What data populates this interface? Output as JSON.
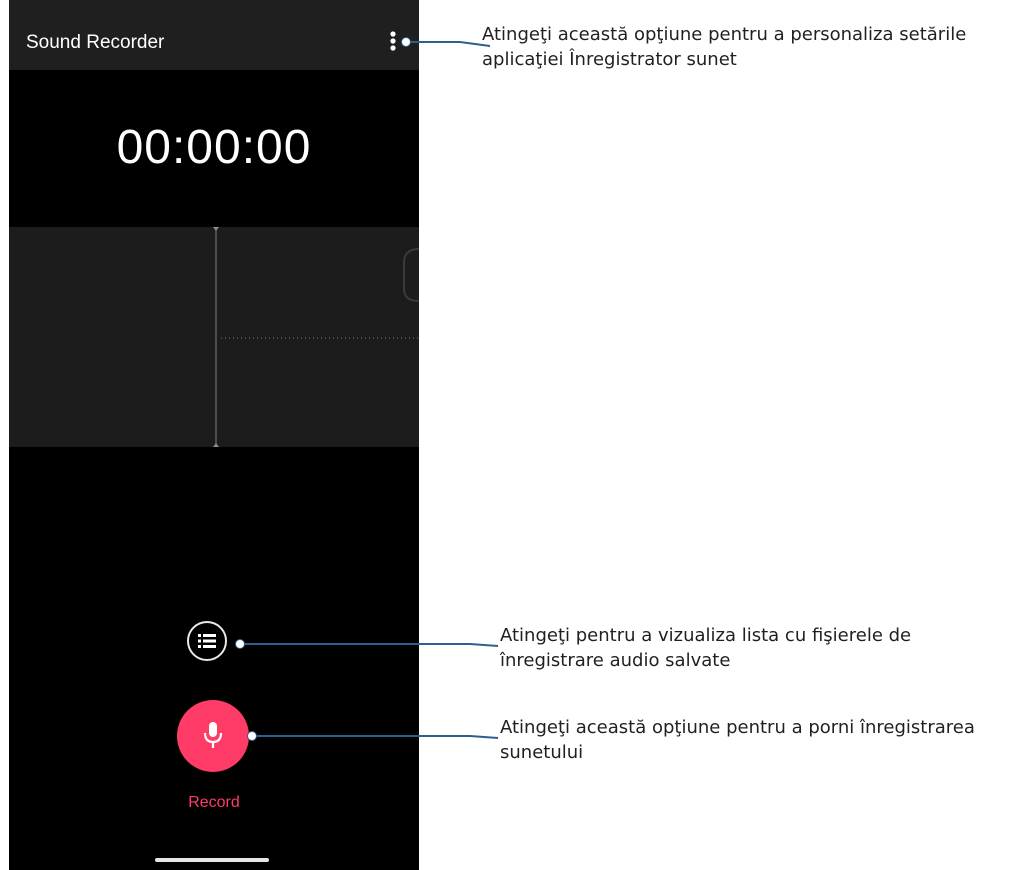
{
  "app": {
    "title": "Sound Recorder"
  },
  "recorder": {
    "timer": "00:00:00",
    "record_label": "Record"
  },
  "icons": {
    "more": "more-vert-icon",
    "list": "list-icon",
    "mic": "microphone-icon"
  },
  "colors": {
    "accent": "#ff3b67",
    "appbar": "#1f1f1f",
    "waveform_bg": "#1c1c1c",
    "callout_line": "#2f5f8f"
  },
  "callouts": {
    "settings": "Atingeţi această opţiune pentru a personaliza setările aplicaţiei Înregistrator sunet",
    "list": "Atingeţi pentru a vizualiza lista cu fişierele de înregistrare audio salvate",
    "record": "Atingeţi această opţiune pentru a porni înregistrarea sunetului"
  }
}
